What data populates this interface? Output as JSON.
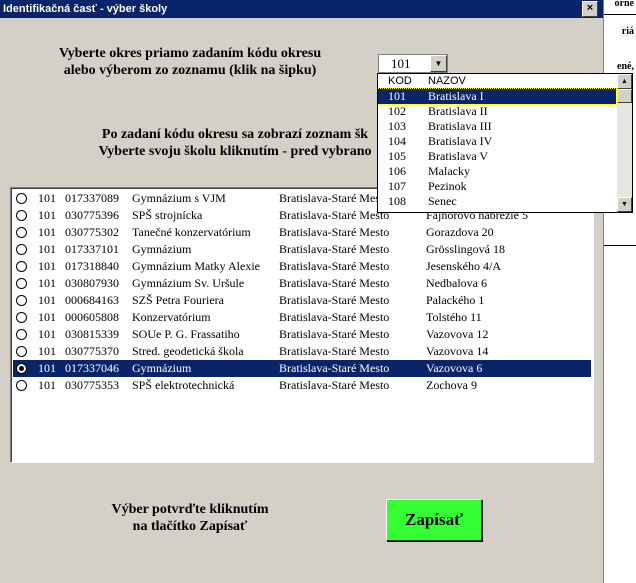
{
  "window": {
    "title": "Identifikačná časť - výber školy",
    "close_label": "×"
  },
  "background_text": {
    "t1": "orne",
    "t2": "riá",
    "t3": "ené,"
  },
  "instructions": {
    "district_line1": "Vyberte okres priamo zadaním kódu okresu",
    "district_line2": "alebo výberom zo zoznamu (klik na šipku)",
    "school_line1": "Po zadaní kódu okresu sa zobrazí zoznam šk",
    "school_line2": "Vyberte svoju školu kliknutím - pred vybrano",
    "confirm_line1": "Výber potvrďte kliknutím",
    "confirm_line2": "na tlačítko Zapísať"
  },
  "district_combo": {
    "value": "101",
    "arrow_icon": "▼"
  },
  "district_dropdown": {
    "headers": {
      "code": "KOD",
      "name": "NAZOV"
    },
    "items": [
      {
        "code": "101",
        "name": "Bratislava I",
        "selected": true
      },
      {
        "code": "102",
        "name": "Bratislava II"
      },
      {
        "code": "103",
        "name": "Bratislava III"
      },
      {
        "code": "104",
        "name": "Bratislava IV"
      },
      {
        "code": "105",
        "name": "Bratislava V"
      },
      {
        "code": "106",
        "name": "Malacky"
      },
      {
        "code": "107",
        "name": "Pezinok"
      },
      {
        "code": "108",
        "name": "Senec"
      }
    ],
    "scroll_up_icon": "▲",
    "scroll_down_icon": "▼"
  },
  "schools": [
    {
      "district": "101",
      "code": "017337089",
      "name": "Gymnázium s VJM",
      "city": "Bratislava-Staré Mesto",
      "address": ""
    },
    {
      "district": "101",
      "code": "030775396",
      "name": "SPŠ strojnícka",
      "city": "Bratislava-Staré Mesto",
      "address": "Fajnorovo nábrežie 5"
    },
    {
      "district": "101",
      "code": "030775302",
      "name": "Tanečné konzervatórium",
      "city": "Bratislava-Staré Mesto",
      "address": "Gorazdova 20"
    },
    {
      "district": "101",
      "code": "017337101",
      "name": "Gymnázium",
      "city": "Bratislava-Staré Mesto",
      "address": "Grösslingová 18"
    },
    {
      "district": "101",
      "code": "017318840",
      "name": "Gymnázium Matky Alexie",
      "city": "Bratislava-Staré Mesto",
      "address": "Jesenského 4/A"
    },
    {
      "district": "101",
      "code": "030807930",
      "name": "Gymnázium Sv. Uršule",
      "city": "Bratislava-Staré Mesto",
      "address": "Nedbalova 6"
    },
    {
      "district": "101",
      "code": "000684163",
      "name": "SZŠ Petra Fouriera",
      "city": "Bratislava-Staré Mesto",
      "address": "Palackého 1"
    },
    {
      "district": "101",
      "code": "000605808",
      "name": "Konzervatórium",
      "city": "Bratislava-Staré Mesto",
      "address": "Tolstého 11"
    },
    {
      "district": "101",
      "code": "030815339",
      "name": "SOUe P. G. Frassatiho",
      "city": "Bratislava-Staré Mesto",
      "address": "Vazovova 12"
    },
    {
      "district": "101",
      "code": "030775370",
      "name": "Stred. geodetická škola",
      "city": "Bratislava-Staré Mesto",
      "address": "Vazovova 14"
    },
    {
      "district": "101",
      "code": "017337046",
      "name": "Gymnázium",
      "city": "Bratislava-Staré Mesto",
      "address": "Vazovova 6",
      "selected": true
    },
    {
      "district": "101",
      "code": "030775353",
      "name": "SPŠ elektrotechnická",
      "city": "Bratislava-Staré Mesto",
      "address": "Zochova 9"
    }
  ],
  "submit_button": {
    "label": "Zapísať",
    "color": "#33ff33"
  },
  "colors": {
    "dialog_bg": "#d4d0c8",
    "titlebar": "#0a246a",
    "selection": "#0a246a"
  }
}
